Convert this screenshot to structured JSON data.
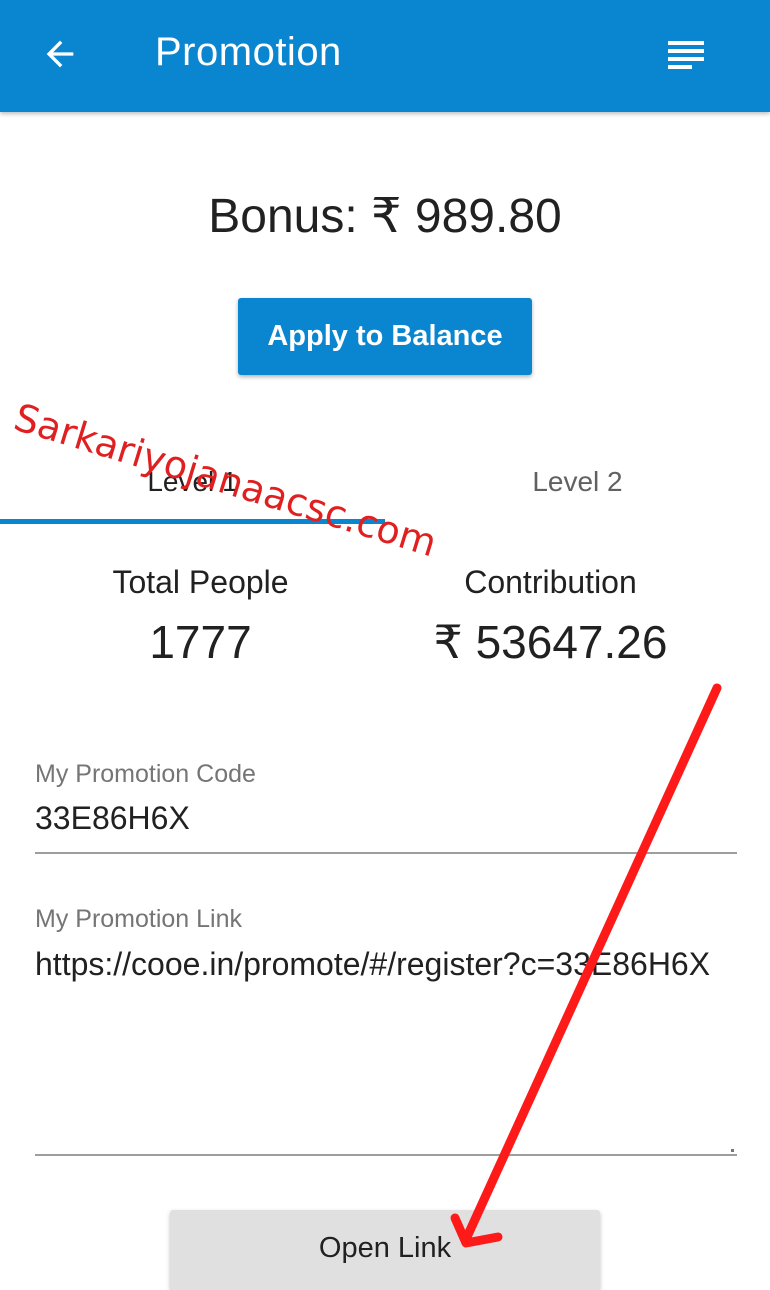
{
  "appbar": {
    "title": "Promotion",
    "back_icon": "arrow-back-icon",
    "menu_icon": "list-menu-icon",
    "color": "#0a86d0"
  },
  "bonus": {
    "text": "Bonus: ₹ 989.80"
  },
  "apply_button": {
    "label": "Apply to Balance"
  },
  "tabs": [
    {
      "label": "Level 1",
      "active": true
    },
    {
      "label": "Level 2",
      "active": false
    }
  ],
  "stats": {
    "total_people_label": "Total People",
    "total_people_value": "1777",
    "contribution_label": "Contribution",
    "contribution_value": "₹ 53647.26"
  },
  "promotion_code": {
    "label": "My Promotion Code",
    "value": "33E86H6X"
  },
  "promotion_link": {
    "label": "My Promotion Link",
    "value": "https://cooe.in/promote/#/register?c=33E86H6X"
  },
  "open_link_button": {
    "label": "Open Link"
  },
  "watermark": {
    "text": "Sarkariyojanaacsc.com",
    "color": "#e02020"
  },
  "annotation": {
    "icon": "red-arrow-icon",
    "color": "#ff1a1a"
  }
}
